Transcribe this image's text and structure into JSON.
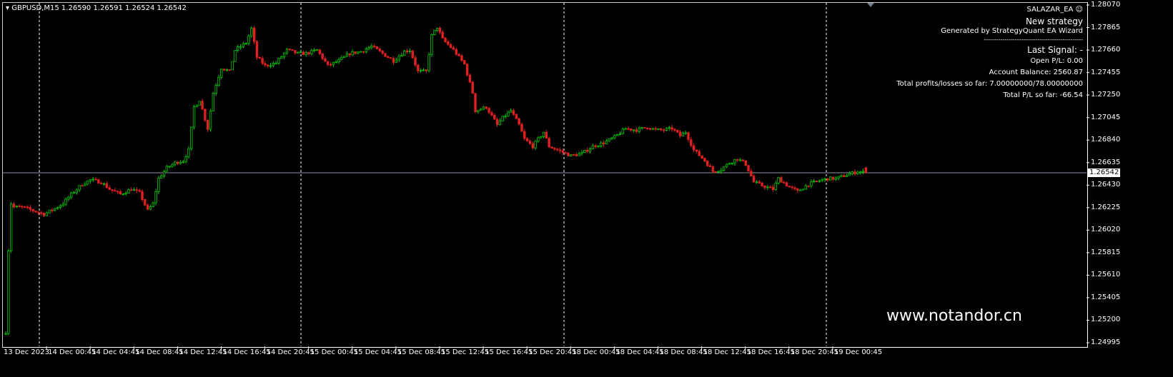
{
  "header": {
    "symbol_line": "GBPUSD,M15  1.26590 1.26591 1.26524 1.26542"
  },
  "panel": {
    "ea_name": "SALAZAR_EA",
    "ea_icon": "smiley-icon",
    "strategy": "New strategy",
    "generated": "Generated by StrategyQuant EA Wizard",
    "separator": "------------------------------------------------",
    "last_signal": "Last Signal:  -",
    "open_pl": "Open P/L: 0.00",
    "balance": "Account Balance: 2560.87",
    "profits_losses": "Total profits/losses so far: 7.00000000/78.00000000",
    "total_pl": "Total P/L so far: -66.54"
  },
  "watermark": "www.notandor.cn",
  "chart_data": {
    "type": "candlestick",
    "title": "GBPUSD,M15",
    "ohlc_last": {
      "open": 1.2659,
      "high": 1.26591,
      "low": 1.26524,
      "close": 1.26542
    },
    "current_price": "1.26542",
    "ylim": [
      1.24995,
      1.2807
    ],
    "y_ticks": [
      "1.28070",
      "1.27865",
      "1.27660",
      "1.27455",
      "1.27250",
      "1.27045",
      "1.26840",
      "1.26635",
      "1.26430",
      "1.26225",
      "1.26020",
      "1.25815",
      "1.25610",
      "1.25405",
      "1.25200",
      "1.24995"
    ],
    "x_ticks": [
      "13 Dec 2023",
      "14 Dec 00:45",
      "14 Dec 04:45",
      "14 Dec 08:45",
      "14 Dec 12:45",
      "14 Dec 16:45",
      "14 Dec 20:45",
      "15 Dec 00:45",
      "15 Dec 04:45",
      "15 Dec 08:45",
      "15 Dec 12:45",
      "15 Dec 16:45",
      "15 Dec 20:45",
      "18 Dec 00:45",
      "18 Dec 04:45",
      "18 Dec 08:45",
      "18 Dec 12:45",
      "18 Dec 16:45",
      "18 Dec 20:45",
      "19 Dec 00:45"
    ],
    "bullish_color": "#00c800",
    "bearish_color": "#e02020",
    "close_path": [
      [
        0,
        1.25093
      ],
      [
        1,
        1.2584
      ],
      [
        2,
        1.26263
      ],
      [
        3,
        1.2623
      ],
      [
        6,
        1.2623
      ],
      [
        10,
        1.26198
      ],
      [
        14,
        1.26165
      ],
      [
        18,
        1.26217
      ],
      [
        21,
        1.26263
      ],
      [
        24,
        1.26347
      ],
      [
        28,
        1.26438
      ],
      [
        31,
        1.26477
      ],
      [
        35,
        1.26458
      ],
      [
        38,
        1.26393
      ],
      [
        42,
        1.26347
      ],
      [
        46,
        1.26393
      ],
      [
        49,
        1.2636
      ],
      [
        52,
        1.26198
      ],
      [
        54,
        1.26263
      ],
      [
        56,
        1.2649
      ],
      [
        59,
        1.26588
      ],
      [
        62,
        1.26633
      ],
      [
        65,
        1.26653
      ],
      [
        67,
        1.2675
      ],
      [
        69,
        1.2714
      ],
      [
        71,
        1.27205
      ],
      [
        74,
        1.26945
      ],
      [
        76,
        1.2727
      ],
      [
        79,
        1.27498
      ],
      [
        82,
        1.27465
      ],
      [
        84,
        1.2766
      ],
      [
        88,
        1.27725
      ],
      [
        90,
        1.27855
      ],
      [
        92,
        1.27595
      ],
      [
        95,
        1.27517
      ],
      [
        99,
        1.27543
      ],
      [
        103,
        1.2766
      ],
      [
        107,
        1.27628
      ],
      [
        110,
        1.27628
      ],
      [
        114,
        1.2766
      ],
      [
        118,
        1.27517
      ],
      [
        122,
        1.27563
      ],
      [
        126,
        1.27628
      ],
      [
        130,
        1.27647
      ],
      [
        134,
        1.27693
      ],
      [
        138,
        1.27628
      ],
      [
        142,
        1.27563
      ],
      [
        146,
        1.27647
      ],
      [
        148,
        1.2766
      ],
      [
        151,
        1.27465
      ],
      [
        154,
        1.27465
      ],
      [
        156,
        1.2779
      ],
      [
        158,
        1.27868
      ],
      [
        160,
        1.27758
      ],
      [
        164,
        1.2766
      ],
      [
        168,
        1.2753
      ],
      [
        171,
        1.2727
      ],
      [
        172,
        1.27108
      ],
      [
        176,
        1.2714
      ],
      [
        180,
        1.26978
      ],
      [
        182,
        1.27043
      ],
      [
        185,
        1.27108
      ],
      [
        188,
        1.26978
      ],
      [
        190,
        1.26848
      ],
      [
        193,
        1.26783
      ],
      [
        197,
        1.26913
      ],
      [
        199,
        1.26783
      ],
      [
        202,
        1.2675
      ],
      [
        205,
        1.26718
      ],
      [
        207,
        1.26698
      ],
      [
        211,
        1.26718
      ],
      [
        215,
        1.26783
      ],
      [
        219,
        1.26815
      ],
      [
        223,
        1.26867
      ],
      [
        227,
        1.26945
      ],
      [
        231,
        1.26932
      ],
      [
        235,
        1.26958
      ],
      [
        238,
        1.26932
      ],
      [
        241,
        1.26932
      ],
      [
        244,
        1.26945
      ],
      [
        247,
        1.2688
      ],
      [
        249,
        1.26913
      ],
      [
        252,
        1.2675
      ],
      [
        256,
        1.26653
      ],
      [
        259,
        1.26555
      ],
      [
        262,
        1.26575
      ],
      [
        265,
        1.26633
      ],
      [
        268,
        1.26672
      ],
      [
        271,
        1.2662
      ],
      [
        274,
        1.26458
      ],
      [
        277,
        1.26425
      ],
      [
        281,
        1.26393
      ],
      [
        283,
        1.2649
      ],
      [
        287,
        1.26412
      ],
      [
        290,
        1.26373
      ],
      [
        294,
        1.26438
      ],
      [
        298,
        1.2647
      ],
      [
        301,
        1.2649
      ],
      [
        304,
        1.2649
      ],
      [
        308,
        1.26523
      ],
      [
        312,
        1.26555
      ],
      [
        315,
        1.26542
      ]
    ]
  }
}
